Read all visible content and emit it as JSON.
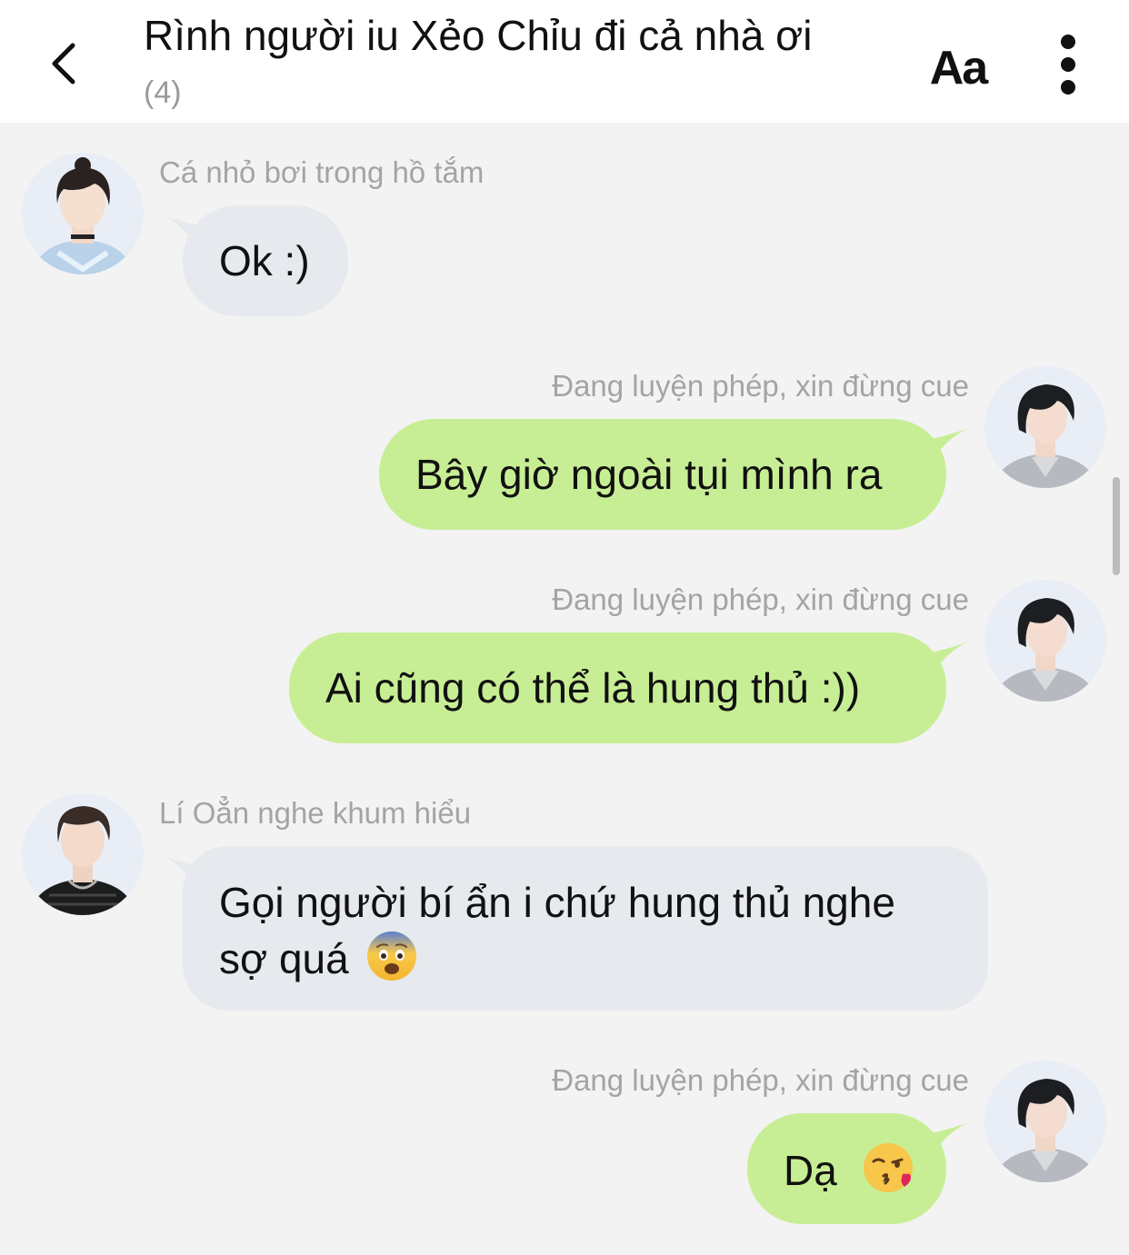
{
  "header": {
    "title": "Rình người iu Xẻo Chỉu đi cả nhà ơi",
    "member_count": "(4)",
    "font_size_label": "Aa"
  },
  "messages": [
    {
      "direction": "incoming",
      "sender": "Cá nhỏ bơi trong hồ tắm",
      "text": "Ok :)"
    },
    {
      "direction": "outgoing",
      "sender": "Đang luyện phép, xin đừng cue",
      "text": "Bây giờ ngoài tụi mình ra"
    },
    {
      "direction": "outgoing",
      "sender": "Đang luyện phép, xin đừng cue",
      "text": "Ai cũng có thể là hung thủ :))"
    },
    {
      "direction": "incoming",
      "sender": "Lí Oẳn nghe khum hiểu",
      "text_line1": "Gọi người bí ẩn i chứ hung thủ nghe",
      "text_line2": "sợ quá",
      "emoji": "fearful-face"
    },
    {
      "direction": "outgoing",
      "sender": "Đang luyện phép, xin đừng cue",
      "text": "Dạ",
      "emoji": "face-blowing-kiss"
    }
  ],
  "colors": {
    "background": "#f3f3f3",
    "incoming_bubble": "#e6e9ed",
    "outgoing_bubble": "#c8ee95",
    "sender_name": "#a4a4a4"
  }
}
